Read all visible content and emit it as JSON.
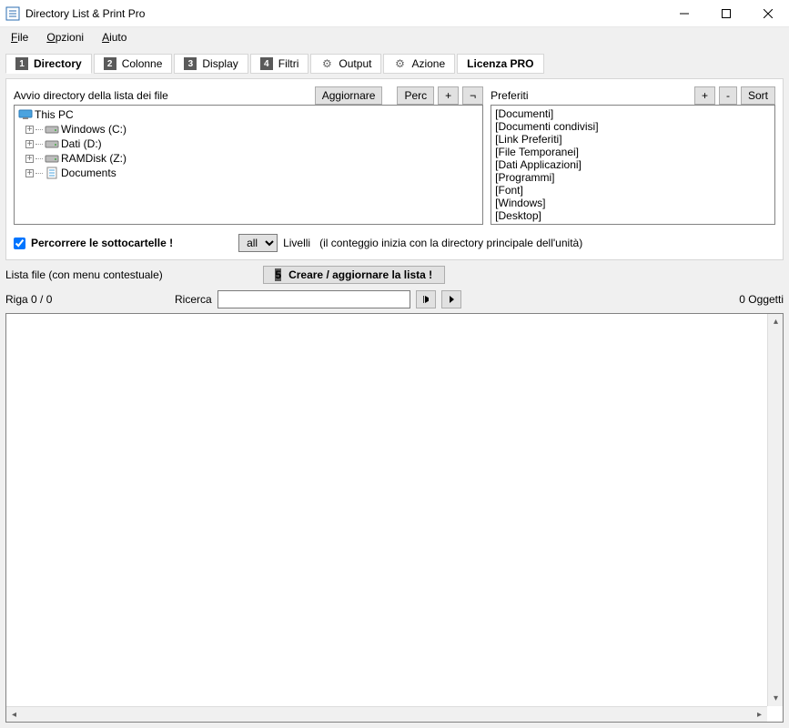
{
  "window": {
    "title": "Directory List & Print Pro"
  },
  "menu": {
    "file": "File",
    "options": "Opzioni",
    "help": "Aiuto"
  },
  "tabs": [
    {
      "num": "1",
      "label": "Directory"
    },
    {
      "num": "2",
      "label": "Colonne"
    },
    {
      "num": "3",
      "label": "Display"
    },
    {
      "num": "4",
      "label": "Filtri"
    },
    {
      "gear": true,
      "label": "Output"
    },
    {
      "gear": true,
      "label": "Azione"
    },
    {
      "label": "Licenza PRO"
    }
  ],
  "left": {
    "heading": "Avvio directory della lista dei file",
    "refresh": "Aggiornare",
    "perc": "Perc",
    "plus": "+",
    "not": "¬",
    "tree_root": "This PC",
    "tree_items": [
      "Windows (C:)",
      "Dati (D:)",
      "RAMDisk (Z:)",
      "Documents"
    ]
  },
  "right": {
    "heading": "Preferiti",
    "plus": "+",
    "minus": "-",
    "sort": "Sort",
    "items": [
      "[Documenti]",
      "[Documenti condivisi]",
      "[Link Preferiti]",
      "[File Temporanei]",
      "[Dati Applicazioni]",
      "[Programmi]",
      "[Font]",
      "[Windows]",
      "[Desktop]"
    ]
  },
  "subfolders": {
    "checkbox_label": "Percorrere le sottocartelle !",
    "select_value": "all",
    "levels_label": "Livelli",
    "hint": "(il conteggio inizia con la directory principale dell'unità)"
  },
  "mid": {
    "list_label": "Lista file (con menu contestuale)",
    "badge": "5",
    "create_btn": "Creare / aggiornare la lista !"
  },
  "search": {
    "row_label": "Riga 0 / 0",
    "search_label": "Ricerca",
    "objects": "0 Oggetti"
  }
}
